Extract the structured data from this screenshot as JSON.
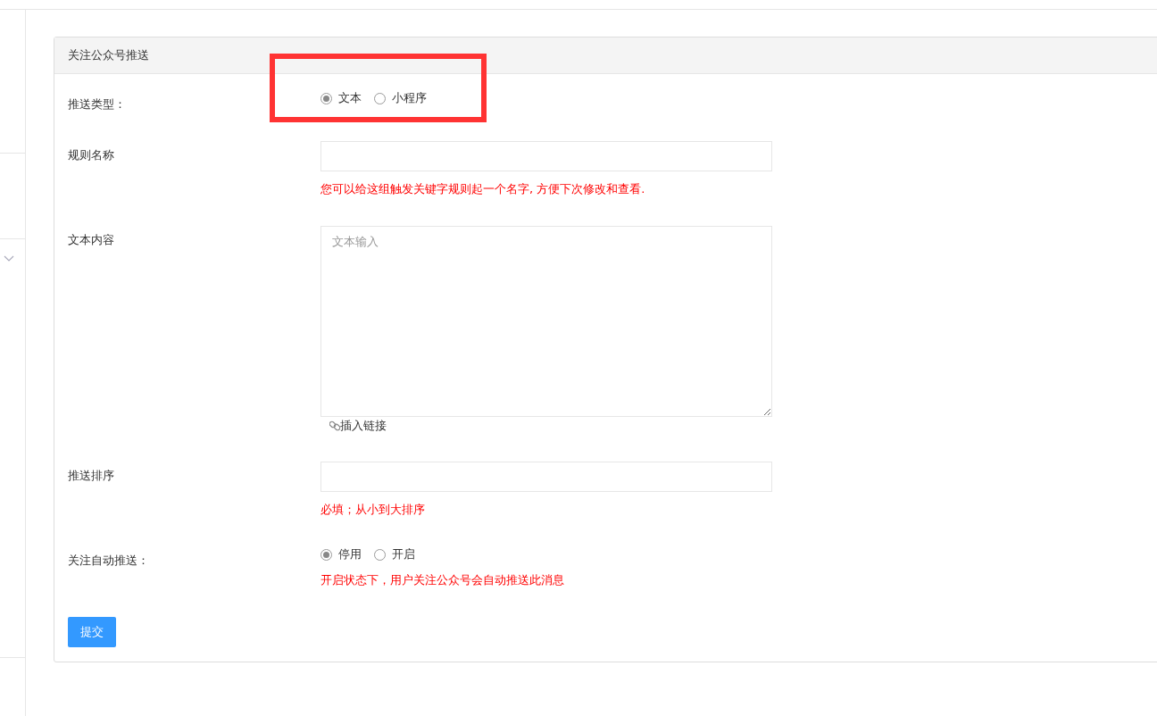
{
  "panel": {
    "title": "关注公众号推送"
  },
  "fields": [
    {
      "kind": "radio",
      "label": "推送类型：",
      "options": [
        {
          "label": "文本",
          "selected": true
        },
        {
          "label": "小程序",
          "selected": false
        }
      ]
    },
    {
      "kind": "input",
      "label": "规则名称",
      "help": "您可以给这组触发关键字规则起一个名字, 方便下次修改和查看."
    },
    {
      "kind": "textarea",
      "label": "文本内容",
      "placeholder": "文本输入",
      "link": "插入链接"
    },
    {
      "kind": "input",
      "label": "推送排序",
      "help": "必填；从小到大排序"
    },
    {
      "kind": "radio",
      "label": "关注自动推送：",
      "options": [
        {
          "label": "停用",
          "selected": true
        },
        {
          "label": "开启",
          "selected": false
        }
      ],
      "help": "开启状态下，用户关注公众号会自动推送此消息"
    }
  ],
  "submit": "提交"
}
